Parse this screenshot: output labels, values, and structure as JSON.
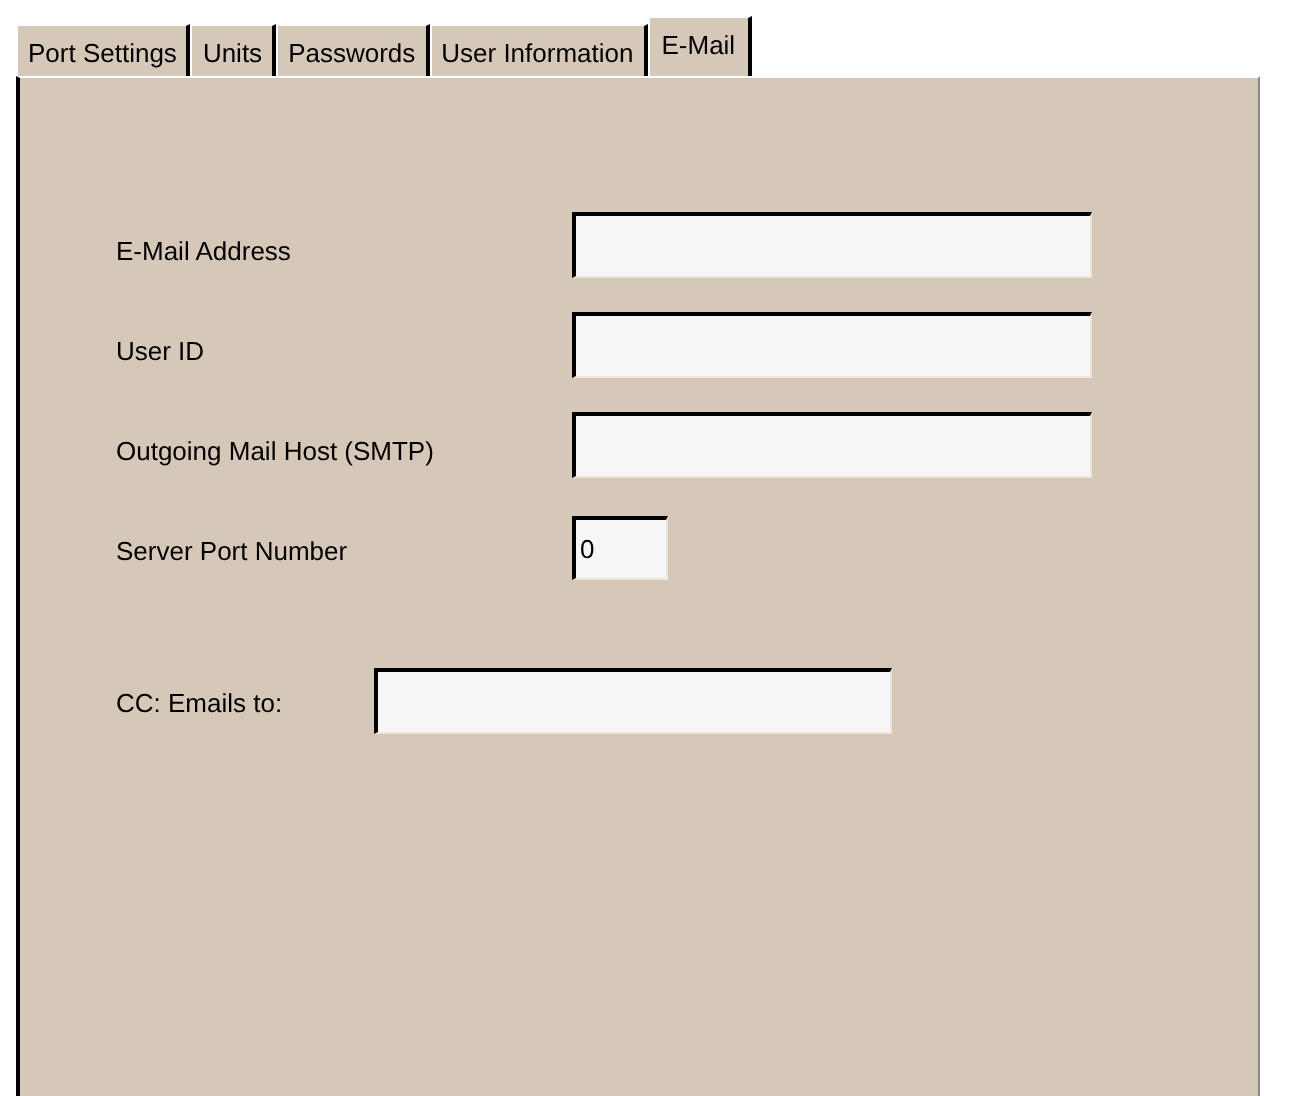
{
  "tabs": [
    {
      "label": "Port Settings",
      "selected": false
    },
    {
      "label": "Units",
      "selected": false
    },
    {
      "label": "Passwords",
      "selected": false
    },
    {
      "label": "User Information",
      "selected": false
    },
    {
      "label": "E-Mail",
      "selected": true
    }
  ],
  "fields": [
    {
      "label": "E-Mail Address",
      "kind": "wide"
    },
    {
      "label": "User ID",
      "kind": "wide"
    },
    {
      "label": "Outgoing Mail Host (SMTP)",
      "kind": "wide"
    },
    {
      "label": "Server Port Number",
      "kind": "short",
      "value": "0"
    }
  ],
  "cc": {
    "label": "CC: Emails to:"
  }
}
